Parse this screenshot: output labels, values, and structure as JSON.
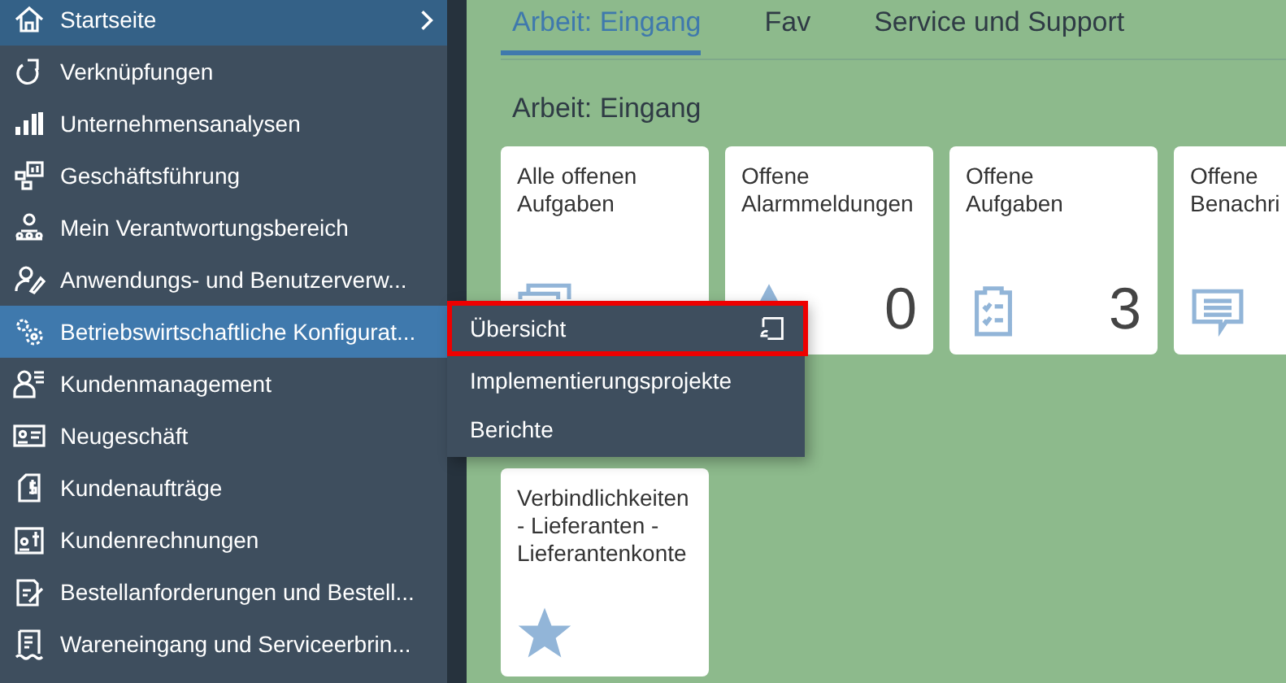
{
  "sidebar": {
    "items": [
      {
        "label": "Startseite",
        "current": true,
        "selected": false,
        "expandable": true
      },
      {
        "label": "Verknüpfungen",
        "current": false,
        "selected": false,
        "expandable": false
      },
      {
        "label": "Unternehmensanalysen",
        "current": false,
        "selected": false,
        "expandable": false
      },
      {
        "label": "Geschäftsführung",
        "current": false,
        "selected": false,
        "expandable": false
      },
      {
        "label": "Mein Verantwortungsbereich",
        "current": false,
        "selected": false,
        "expandable": false
      },
      {
        "label": "Anwendungs- und Benutzerverw...",
        "current": false,
        "selected": false,
        "expandable": false
      },
      {
        "label": "Betriebswirtschaftliche Konfigurat...",
        "current": false,
        "selected": true,
        "expandable": false
      },
      {
        "label": "Kundenmanagement",
        "current": false,
        "selected": false,
        "expandable": false
      },
      {
        "label": "Neugeschäft",
        "current": false,
        "selected": false,
        "expandable": false
      },
      {
        "label": "Kundenaufträge",
        "current": false,
        "selected": false,
        "expandable": false
      },
      {
        "label": "Kundenrechnungen",
        "current": false,
        "selected": false,
        "expandable": false
      },
      {
        "label": "Bestellanforderungen und Bestell...",
        "current": false,
        "selected": false,
        "expandable": false
      },
      {
        "label": "Wareneingang und Serviceerbrin...",
        "current": false,
        "selected": false,
        "expandable": false
      }
    ]
  },
  "flyout": {
    "items": [
      {
        "label": "Übersicht",
        "selected": true
      },
      {
        "label": "Implementierungsprojekte",
        "selected": false
      },
      {
        "label": "Berichte",
        "selected": false
      }
    ]
  },
  "tabs": [
    {
      "label": "Arbeit: Eingang",
      "selected": true
    },
    {
      "label": "Fav",
      "selected": false
    },
    {
      "label": "Service und Support",
      "selected": false
    }
  ],
  "section_title": "Arbeit: Eingang",
  "tile_rows": [
    [
      {
        "title_lines": [
          "Alle offenen",
          "Aufgaben"
        ]
      },
      {
        "title_lines": [
          "Offene",
          "Alarmmeldungen"
        ],
        "number": "0"
      },
      {
        "title_lines": [
          "Offene",
          "Aufgaben"
        ],
        "number": "3"
      },
      {
        "title_lines": [
          "Offene",
          "Benachri"
        ]
      }
    ],
    [
      {
        "title_lines": [
          "Verbindlichkeiten",
          "- Lieferanten -",
          "Lieferantenkonte"
        ]
      }
    ]
  ]
}
